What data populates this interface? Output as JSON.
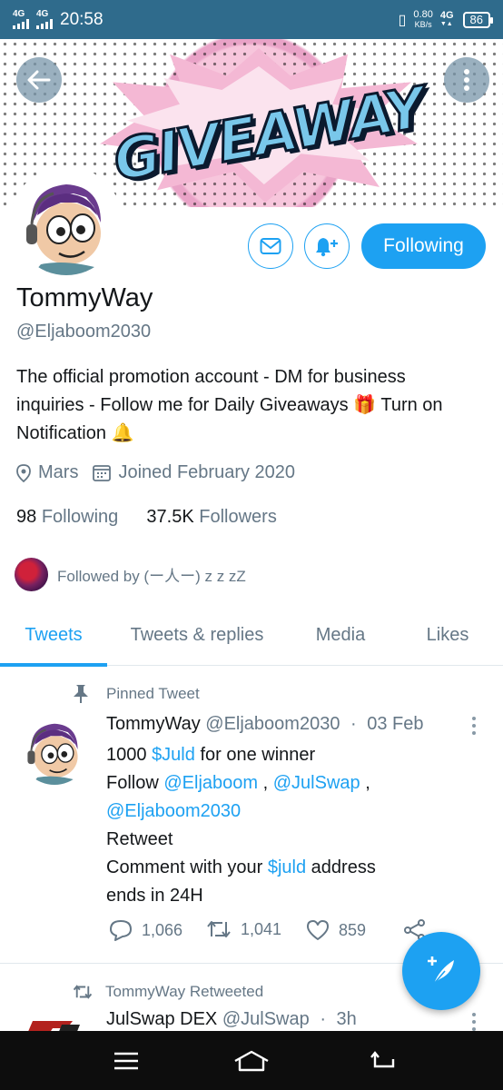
{
  "status_bar": {
    "net1": "4G",
    "net2": "4G",
    "time": "20:58",
    "speed_value": "0.80",
    "speed_unit": "KB/s",
    "net3": "4G",
    "battery": "86"
  },
  "banner": {
    "text": "GIVEAWAY"
  },
  "profile": {
    "name": "TommyWay",
    "handle": "@Eljaboom2030",
    "bio_line1": "The official promotion account - DM for business",
    "bio_line2_a": "inquiries - Follow me for Daily Giveaways",
    "bio_gift": "🎁",
    "bio_line2_b": "Turn on",
    "bio_line3": "Notification",
    "bio_bell": "🔔",
    "location": "Mars",
    "joined": "Joined February 2020",
    "following_count": "98",
    "following_label": "Following",
    "followers_count": "37.5K",
    "followers_label": "Followers",
    "followed_by": "Followed by (ー人ー) z z zZ",
    "following_button": "Following"
  },
  "tabs": [
    {
      "label": "Tweets"
    },
    {
      "label": "Tweets & replies"
    },
    {
      "label": "Media"
    },
    {
      "label": "Likes"
    }
  ],
  "pinned_tweet": {
    "label": "Pinned Tweet",
    "name": "TommyWay",
    "handle": "@Eljaboom2030",
    "sep": "·",
    "date": "03 Feb",
    "line1_a": "1000",
    "line1_link": "$Juld",
    "line1_b": "for one winner",
    "line2_a": "Follow",
    "line2_link1": "@Eljaboom",
    "line2_sep": ",",
    "line2_link2": "@JulSwap",
    "line2_end": ",",
    "line3_link": "@Eljaboom2030",
    "line4": "Retweet",
    "line5_a": "Comment with your",
    "line5_link": "$juld",
    "line5_b": "address",
    "line6": "ends in 24H",
    "replies": "1,066",
    "retweets": "1,041",
    "likes": "859"
  },
  "retweet": {
    "label": "TommyWay Retweeted",
    "name": "JulSwap DEX",
    "handle": "@JulSwap",
    "sep": "·",
    "time": "3h"
  },
  "icons": {
    "accent": "#1da1f2",
    "muted": "#657786"
  }
}
